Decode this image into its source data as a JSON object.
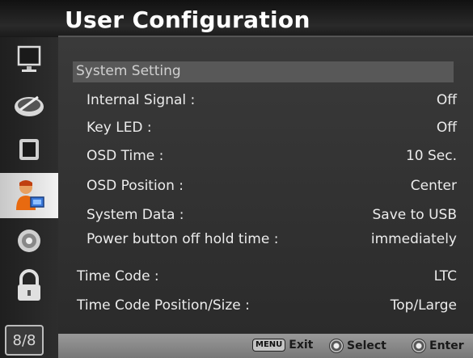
{
  "header": {
    "title": "User Configuration"
  },
  "sidebar": {
    "icons": [
      "monitor-icon",
      "color-adjust-icon",
      "picture-icon",
      "user-icon",
      "dial-icon",
      "lock-icon"
    ],
    "active_index": 3,
    "page_indicator": "8/8"
  },
  "section": {
    "label": "System Setting"
  },
  "settings": [
    {
      "label": "Internal Signal :",
      "value": "Off"
    },
    {
      "label": "Key LED :",
      "value": "Off"
    },
    {
      "label": "OSD Time :",
      "value": "10 Sec."
    },
    {
      "label": "OSD Position :",
      "value": "Center"
    },
    {
      "label": "System Data :",
      "value": "Save to USB"
    },
    {
      "label": "Power button off hold time :",
      "value": "immediately"
    }
  ],
  "top_settings": [
    {
      "label": "Time Code :",
      "value": "LTC"
    },
    {
      "label": "Time Code Position/Size :",
      "value": "Top/Large"
    }
  ],
  "footer": {
    "menu_key": "MENU",
    "exit_label": "Exit",
    "select_label": "Select",
    "enter_label": "Enter"
  },
  "colors": {
    "active_tab": "#e6e6e6",
    "panel": "#333333",
    "footer": "#8a8a8a",
    "text": "#ececec"
  }
}
